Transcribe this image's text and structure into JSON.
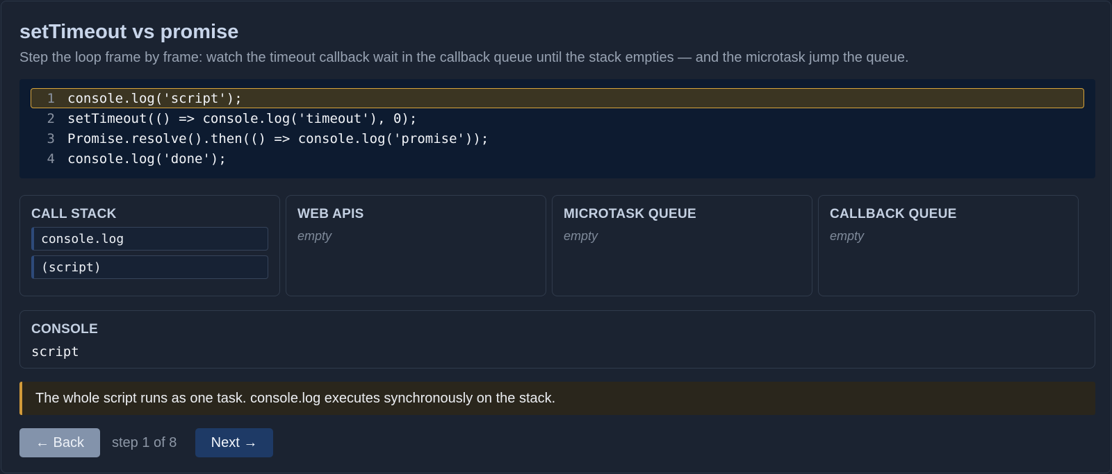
{
  "header": {
    "title": "setTimeout vs promise",
    "subtitle": "Step the loop frame by frame: watch the timeout callback wait in the callback queue until the stack empties — and the microtask jump the queue."
  },
  "code": {
    "lines": [
      {
        "no": "1",
        "text": "console.log('script');",
        "active": true
      },
      {
        "no": "2",
        "text": "setTimeout(() => console.log('timeout'), 0);",
        "active": false
      },
      {
        "no": "3",
        "text": "Promise.resolve().then(() => console.log('promise'));",
        "active": false
      },
      {
        "no": "4",
        "text": "console.log('done');",
        "active": false
      }
    ]
  },
  "panels": {
    "call_stack": {
      "title": "CALL STACK",
      "frames": [
        "console.log",
        "(script)"
      ]
    },
    "web_apis": {
      "title": "WEB APIS",
      "empty": "empty"
    },
    "microtask_queue": {
      "title": "MICROTASK QUEUE",
      "empty": "empty"
    },
    "callback_queue": {
      "title": "CALLBACK QUEUE",
      "empty": "empty"
    }
  },
  "console": {
    "title": "CONSOLE",
    "output": "script"
  },
  "note": "The whole script runs as one task. console.log executes synchronously on the stack.",
  "controls": {
    "back_label": "← Back",
    "next_label": "Next →",
    "step_text": "step 1 of 8"
  },
  "colors": {
    "highlight_border": "#d9a53c",
    "note_accent": "#d19a3a",
    "next_button": "#1e3a66",
    "back_button": "#8393ab"
  }
}
